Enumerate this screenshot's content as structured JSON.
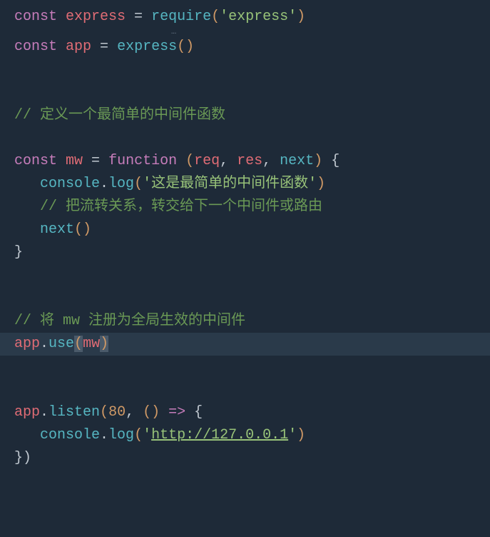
{
  "lines": {
    "l1_const": "const",
    "l1_express": "express",
    "l1_eq": " = ",
    "l1_require": "require",
    "l1_lp": "(",
    "l1_str": "'express'",
    "l1_rp": ")",
    "hint_dots": "…",
    "l2_const": "const",
    "l2_app": "app",
    "l2_eq": " = ",
    "l2_express": "express",
    "l2_lp": "(",
    "l2_rp": ")",
    "l3_slash": "//",
    "l3_comment": " 定义一个最简单的中间件函数",
    "l4_const": "const",
    "l4_mw": "mw",
    "l4_eq": " = ",
    "l4_function": "function",
    "l4_lp": " (",
    "l4_req": "req",
    "l4_c1": ", ",
    "l4_res": "res",
    "l4_c2": ", ",
    "l4_next": "next",
    "l4_rp": ")",
    "l4_brace": " {",
    "l5_indent": "   ",
    "l5_console": "console",
    "l5_dot": ".",
    "l5_log": "log",
    "l5_lp": "(",
    "l5_str": "'这是最简单的中间件函数'",
    "l5_rp": ")",
    "l6_indent": "   ",
    "l6_slash": "//",
    "l6_comment": " 把流转关系，转交给下一个中间件或路由",
    "l7_indent": "   ",
    "l7_next": "next",
    "l7_lp": "(",
    "l7_rp": ")",
    "l8_brace": "}",
    "l9_slash": "//",
    "l9_comment_p1": " 将 ",
    "l9_mw": "mw",
    "l9_comment_p2": " 注册为全局生效的中间件",
    "l10_app": "app",
    "l10_dot": ".",
    "l10_use": "use",
    "l10_lp": "(",
    "l10_mw": "mw",
    "l10_rp": ")",
    "l11_app": "app",
    "l11_dot": ".",
    "l11_listen": "listen",
    "l11_lp": "(",
    "l11_num": "80",
    "l11_c": ", ",
    "l11_lp2": "(",
    "l11_rp2": ")",
    "l11_arrow": " => ",
    "l11_brace": "{",
    "l12_indent": "   ",
    "l12_console": "console",
    "l12_dot": ".",
    "l12_log": "log",
    "l12_lp": "(",
    "l12_str_q1": "'",
    "l12_url": "http://127.0.0.1",
    "l12_str_q2": "'",
    "l12_rp": ")",
    "l13_brace": "})"
  }
}
